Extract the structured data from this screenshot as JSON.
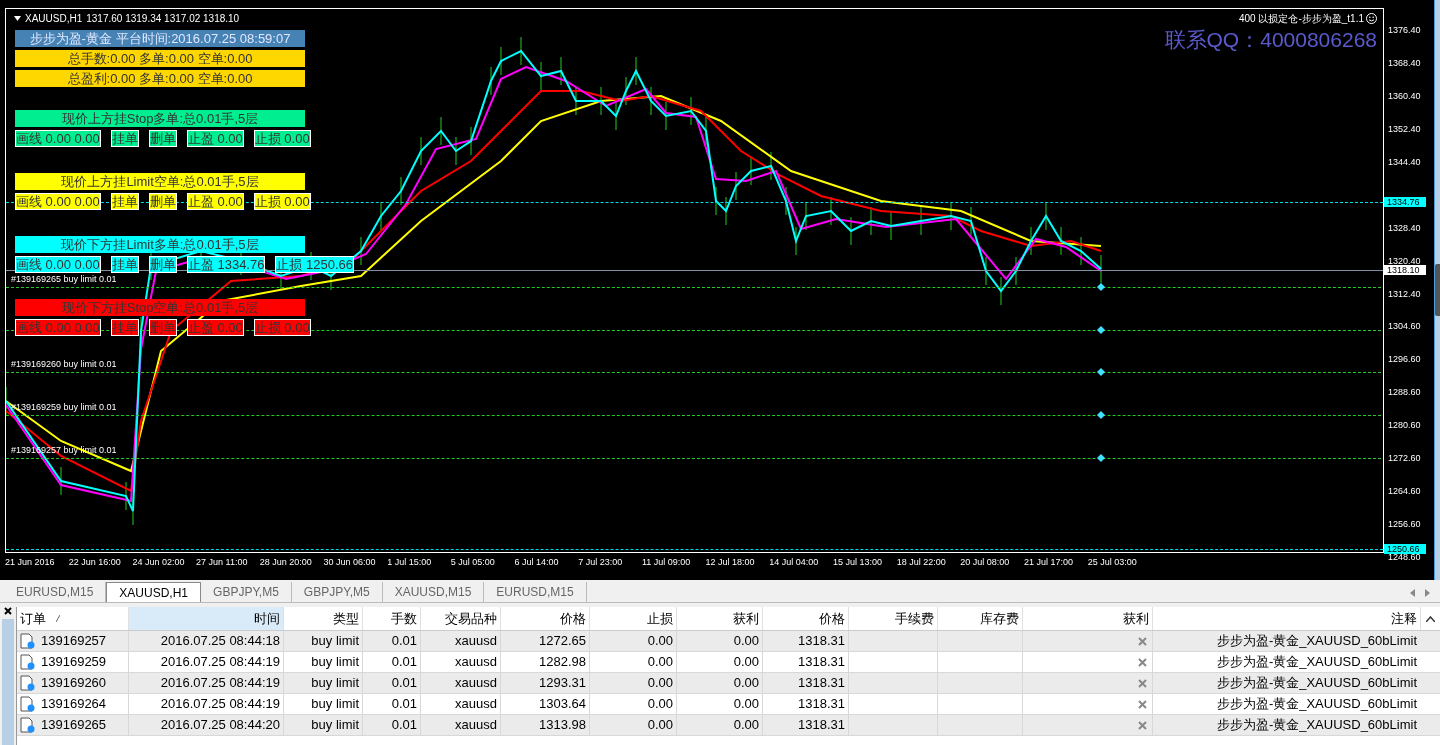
{
  "chart": {
    "symbol": "XAUUSD,H1",
    "ohlc": "1317.60 1319.34 1317.02 1318.10",
    "expert": "400 以损定仓-步步为盈_t1.1",
    "contact": "联系QQ：4000806268",
    "price_ticks": [
      "1376.40",
      "1368.40",
      "1360.40",
      "1352.40",
      "1344.40",
      "1328.40",
      "1320.40",
      "1312.40",
      "1304.60",
      "1296.60",
      "1288.60",
      "1280.60",
      "1272.60",
      "1264.60",
      "1256.60",
      "1248.60"
    ],
    "price_tags": [
      {
        "text": "1334.76",
        "kind": "level"
      },
      {
        "text": "1318.10",
        "kind": "bid"
      },
      {
        "text": "1250.66",
        "kind": "level"
      }
    ],
    "time_ticks": [
      "21 Jun 2016",
      "22 Jun 16:00",
      "24 Jun 02:00",
      "27 Jun 11:00",
      "28 Jun 20:00",
      "30 Jun 06:00",
      "1 Jul 15:00",
      "5 Jul 05:00",
      "6 Jul 14:00",
      "7 Jul 23:00",
      "11 Jul 09:00",
      "12 Jul 18:00",
      "14 Jul 04:00",
      "15 Jul 13:00",
      "18 Jul 22:00",
      "20 Jul 08:00",
      "21 Jul 17:00",
      "25 Jul 03:00"
    ],
    "order_lines": [
      {
        "kind": "labelled",
        "label": "#139169265 buy limit 0.01"
      },
      {
        "kind": "plain"
      },
      {
        "kind": "labelled",
        "label": "#139169260 buy limit 0.01"
      },
      {
        "kind": "labelled",
        "label": "#139169259 buy limit 0.01"
      },
      {
        "kind": "labelled",
        "label": "#139169257 buy limit 0.01"
      }
    ]
  },
  "panel": {
    "title": "步步为盈-黄金 平台时间:2016.07.25 08:59:07",
    "stats": [
      "总手数:0.00 多单:0.00 空单:0.00",
      "总盈利:0.00 多单:0.00 空单:0.00"
    ],
    "groups": [
      {
        "title": "现价上方挂Stop多单:总0.01手,5层",
        "color": "#00ee90",
        "buttons": [
          "画线 0.00 0.00",
          "挂单",
          "删单",
          "止盈 0.00",
          "止损 0.00"
        ]
      },
      {
        "title": "现价上方挂Limit空单:总0.01手,5层",
        "color": "#ffff00",
        "buttons": [
          "画线 0.00 0.00",
          "挂单",
          "删单",
          "止盈 0.00",
          "止损 0.00"
        ]
      },
      {
        "title": "现价下方挂Limit多单:总0.01手,5层",
        "color": "#00ffff",
        "buttons": [
          "画线 0.00 0.00",
          "挂单",
          "删单",
          "止盈 1334.76",
          "止损 1250.66"
        ]
      },
      {
        "title": "现价下方挂Stop空单:总0.01手,5层",
        "color": "#ff0000",
        "buttons": [
          "画线 0.00 0.00",
          "挂单",
          "删单",
          "止盈 0.00",
          "止损 0.00"
        ]
      }
    ]
  },
  "tabs": [
    {
      "label": "EURUSD,M15",
      "selected": false
    },
    {
      "label": "XAUUSD,H1",
      "selected": true
    },
    {
      "label": "GBPJPY,M5",
      "selected": false
    },
    {
      "label": "GBPJPY,M5",
      "selected": false
    },
    {
      "label": "XAUUSD,M15",
      "selected": false
    },
    {
      "label": "EURUSD,M15",
      "selected": false
    }
  ],
  "table": {
    "columns": [
      {
        "label": "订单",
        "selected": false
      },
      {
        "label": "时间",
        "selected": true
      },
      {
        "label": "类型",
        "selected": false
      },
      {
        "label": "手数",
        "selected": false
      },
      {
        "label": "交易品种",
        "selected": false
      },
      {
        "label": "价格",
        "selected": false
      },
      {
        "label": "止损",
        "selected": false
      },
      {
        "label": "获利",
        "selected": false
      },
      {
        "label": "价格",
        "selected": false
      },
      {
        "label": "手续费",
        "selected": false
      },
      {
        "label": "库存费",
        "selected": false
      },
      {
        "label": "获利",
        "selected": false
      },
      {
        "label": "注释",
        "selected": false
      }
    ],
    "rows": [
      {
        "order": "139169257",
        "time": "2016.07.25 08:44:18",
        "type": "buy limit",
        "lots": "0.01",
        "symbol": "xauusd",
        "price": "1272.65",
        "sl": "0.00",
        "tp": "0.00",
        "market_price": "1318.31",
        "comment": "步步为盈-黄金_XAUUSD_60bLimit"
      },
      {
        "order": "139169259",
        "time": "2016.07.25 08:44:19",
        "type": "buy limit",
        "lots": "0.01",
        "symbol": "xauusd",
        "price": "1282.98",
        "sl": "0.00",
        "tp": "0.00",
        "market_price": "1318.31",
        "comment": "步步为盈-黄金_XAUUSD_60bLimit"
      },
      {
        "order": "139169260",
        "time": "2016.07.25 08:44:19",
        "type": "buy limit",
        "lots": "0.01",
        "symbol": "xauusd",
        "price": "1293.31",
        "sl": "0.00",
        "tp": "0.00",
        "market_price": "1318.31",
        "comment": "步步为盈-黄金_XAUUSD_60bLimit"
      },
      {
        "order": "139169264",
        "time": "2016.07.25 08:44:19",
        "type": "buy limit",
        "lots": "0.01",
        "symbol": "xauusd",
        "price": "1303.64",
        "sl": "0.00",
        "tp": "0.00",
        "market_price": "1318.31",
        "comment": "步步为盈-黄金_XAUUSD_60bLimit"
      },
      {
        "order": "139169265",
        "time": "2016.07.25 08:44:20",
        "type": "buy limit",
        "lots": "0.01",
        "symbol": "xauusd",
        "price": "1313.98",
        "sl": "0.00",
        "tp": "0.00",
        "market_price": "1318.31",
        "comment": "步步为盈-黄金_XAUUSD_60bLimit"
      }
    ]
  }
}
